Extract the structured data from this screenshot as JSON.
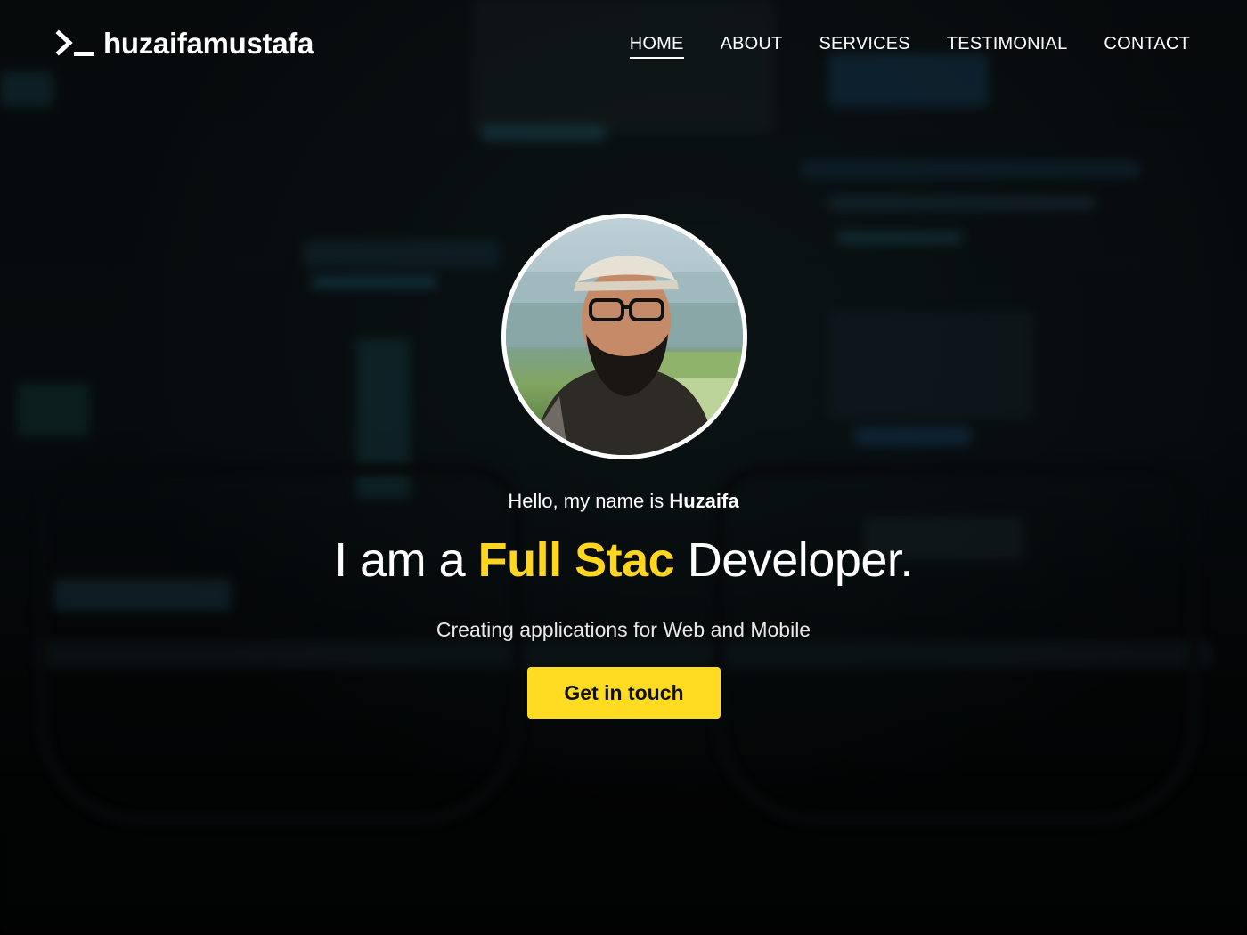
{
  "nav": {
    "brand_name": "huzaifamustafa",
    "brand_icon": "terminal-prompt-icon",
    "items": [
      {
        "label": "HOME",
        "active": true
      },
      {
        "label": "ABOUT",
        "active": false
      },
      {
        "label": "SERVICES",
        "active": false
      },
      {
        "label": "TESTIMONIAL",
        "active": false
      },
      {
        "label": "CONTACT",
        "active": false
      }
    ]
  },
  "hero": {
    "greeting_prefix": "Hello, my name is ",
    "greeting_name": "Huzaifa",
    "headline_prefix": "I am a ",
    "headline_highlight": "Full Stac",
    "headline_suffix": " Developer.",
    "subline": "Creating applications for Web and Mobile",
    "cta_label": "Get in touch"
  },
  "colors": {
    "accent": "#ffdb21",
    "highlight_text": "#ffd51e",
    "text": "#ffffff",
    "background": "#07090b"
  }
}
